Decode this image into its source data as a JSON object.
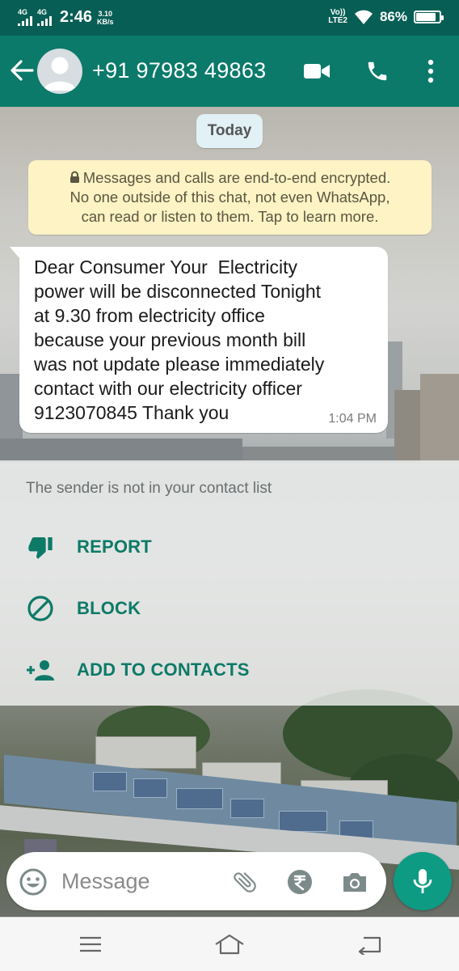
{
  "status_bar": {
    "net1": "4G",
    "net2": "4G",
    "time": "2:46",
    "speed_value": "3.10",
    "speed_unit": "KB/s",
    "volte_line1": "Vo))",
    "volte_line2": "LTE2",
    "battery_percent": "86%",
    "battery_level": 0.86
  },
  "app_bar": {
    "contact_name": "+91 97983 49863",
    "icons": [
      "back-arrow-icon",
      "video-call-icon",
      "phone-icon",
      "more-vert-icon"
    ]
  },
  "chat": {
    "date_chip": "Today",
    "encryption_notice": "Messages and calls are end-to-end encrypted. No one outside of this chat, not even WhatsApp, can read or listen to them. Tap to learn more.",
    "encryption_lines": [
      "Messages and calls are end-to-end encrypted.",
      "No one outside of this chat, not even WhatsApp,",
      "can read or listen to them. Tap to learn more."
    ],
    "messages": [
      {
        "text": "Dear Consumer Your  Electricity\npower will be disconnected Tonight\nat 9.30 from electricity office\nbecause your previous month bill\nwas not update please immediately\ncontact with our electricity officer\n9123070845 Thank you",
        "time": "1:04 PM",
        "direction": "incoming"
      }
    ]
  },
  "unknown_sender": {
    "note": "The sender is not in your contact list",
    "actions": [
      {
        "label": "REPORT",
        "icon": "thumb-down-icon"
      },
      {
        "label": "BLOCK",
        "icon": "block-icon"
      },
      {
        "label": "ADD TO CONTACTS",
        "icon": "add-person-icon"
      }
    ]
  },
  "composer": {
    "placeholder": "Message",
    "icons": [
      "emoji-icon",
      "attach-icon",
      "rupee-payment-icon",
      "camera-icon",
      "mic-icon"
    ]
  },
  "system_nav": {
    "icons": [
      "menu-icon",
      "home-icon",
      "back-icon"
    ]
  },
  "colors": {
    "header": "#0b7a6a",
    "status_bar": "#075e54",
    "accent": "#0d7a68",
    "mic_button": "#0d9b84",
    "encryption_bg": "#fdf3c4",
    "date_chip_bg": "#e1f1f6"
  }
}
